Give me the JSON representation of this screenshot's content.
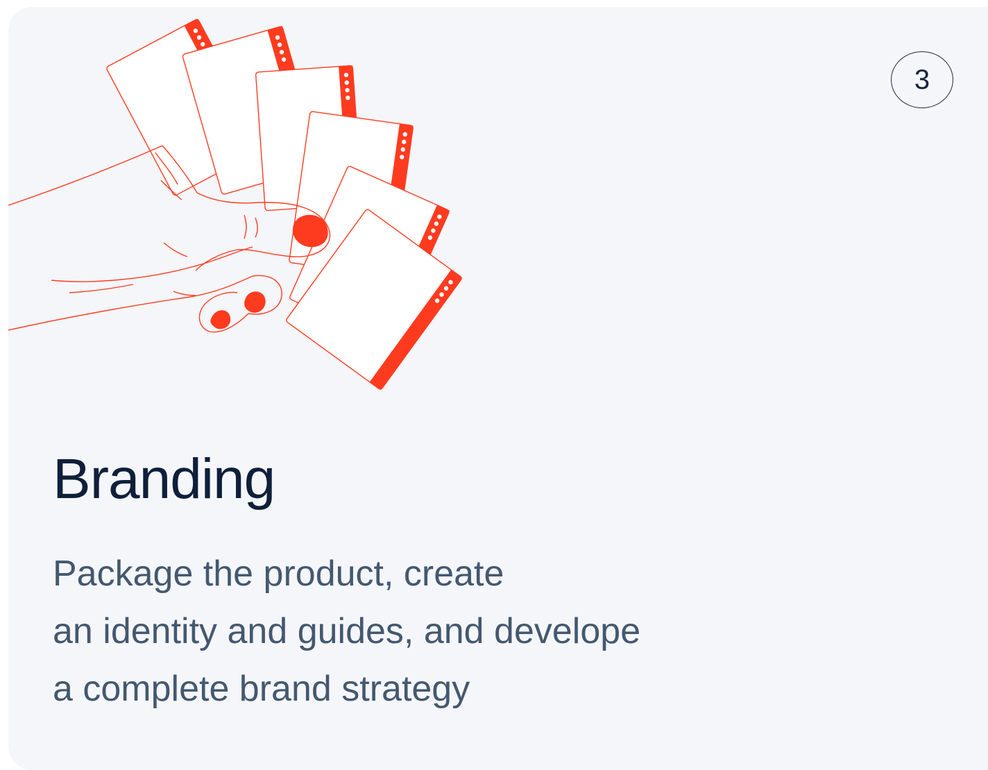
{
  "card": {
    "step_number": "3",
    "title": "Branding",
    "description_lines": [
      "Package the product, create",
      "an identity and guides, and develope",
      "a complete brand strategy"
    ]
  },
  "illustration": {
    "icon": "hand-holding-cards-icon",
    "accent_color": "#ff3b1f",
    "card_color": "#ffffff"
  },
  "colors": {
    "background": "#f4f6fa",
    "title": "#0f1f3a",
    "description": "#44586f"
  }
}
